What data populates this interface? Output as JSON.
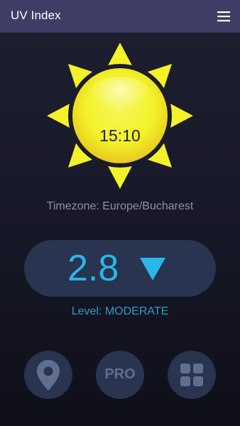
{
  "app": {
    "title": "UV Index"
  },
  "clock": {
    "time": "15:10"
  },
  "location": {
    "timezone_text": "Timezone: Europe/Bucharest"
  },
  "uv": {
    "value": "2.8",
    "trend": "down",
    "level_text": "Level: MODERATE"
  },
  "actions": {
    "pro_label": "PRO"
  },
  "icons": {
    "menu": "hamburger-menu-icon",
    "sun": "sun-icon",
    "trend": "triangle-down-icon",
    "location": "map-pin-icon",
    "apps": "grid-icon"
  },
  "colors": {
    "appbar": "#3f3d66",
    "background": "#171827",
    "sun_yellow": "#f3f229",
    "uv_value": "#29b6e8",
    "level": "#3199c4",
    "button_bg": "#283450",
    "button_icon": "#606e90"
  }
}
